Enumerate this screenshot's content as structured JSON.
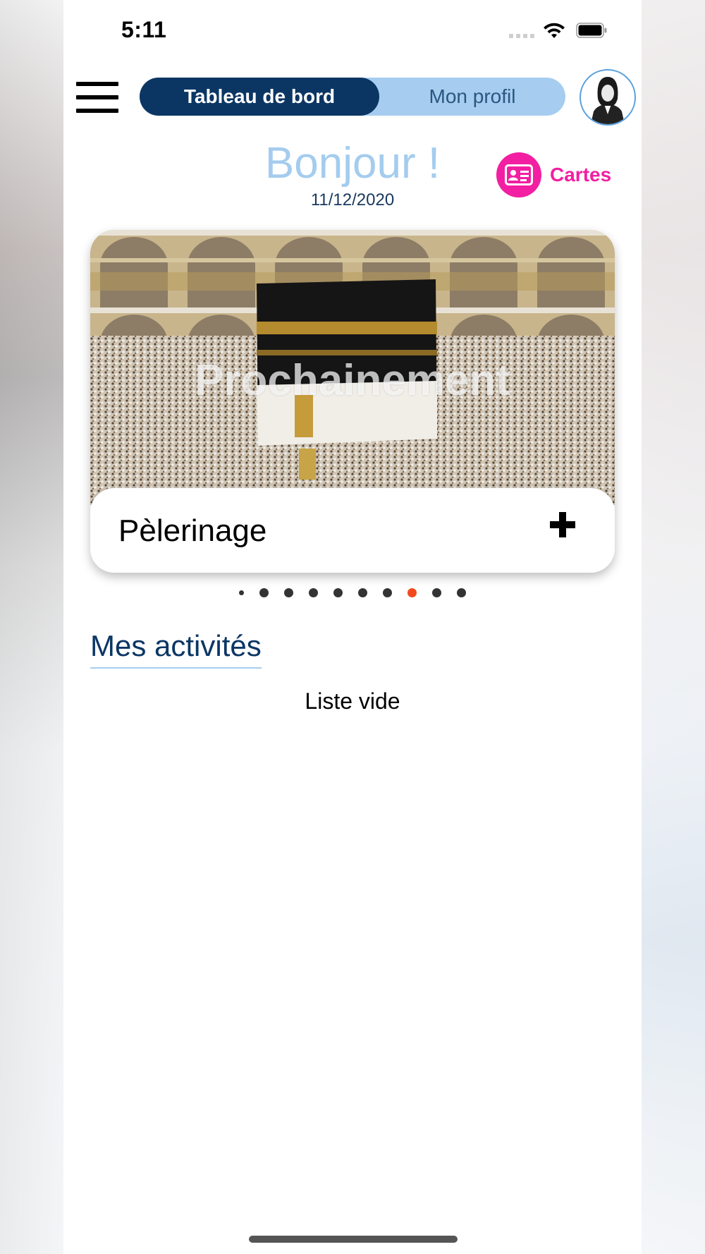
{
  "status_bar": {
    "time": "5:11"
  },
  "header": {
    "segments": [
      {
        "label": "Tableau de bord",
        "active": true
      },
      {
        "label": "Mon profil",
        "active": false
      }
    ]
  },
  "greeting": {
    "title": "Bonjour !",
    "date": "11/12/2020"
  },
  "cartes": {
    "label": "Cartes"
  },
  "carousel": {
    "overlay_text": "Prochainement",
    "card_title": "Pèlerinage",
    "dots_total": 10,
    "active_index": 7
  },
  "activities": {
    "title": "Mes activités",
    "empty_text": "Liste vide"
  },
  "colors": {
    "navy": "#0b3664",
    "light_blue": "#a6cdef",
    "pink": "#f21fa2",
    "active_dot": "#f24a1e"
  }
}
